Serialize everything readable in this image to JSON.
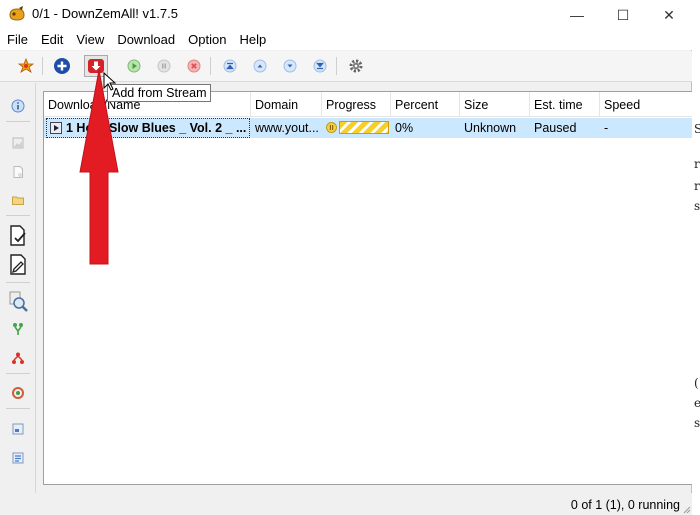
{
  "window": {
    "title": "0/1 - DownZemAll! v1.7.5",
    "controls": {
      "minimize": "—",
      "maximize": "☐",
      "close": "✕"
    }
  },
  "menu": [
    "File",
    "Edit",
    "View",
    "Download",
    "Option",
    "Help"
  ],
  "toolbar": {
    "tooltip": "Add from Stream",
    "buttons": [
      "wizard-icon",
      "add-icon",
      "add-from-stream-icon",
      "start-icon",
      "pause-icon",
      "stop-icon",
      "move-top-icon",
      "move-up-icon",
      "move-down-icon",
      "move-bottom-icon",
      "settings-icon"
    ]
  },
  "table": {
    "columns": [
      "Download/Name",
      "Domain",
      "Progress",
      "Percent",
      "Size",
      "Est. time",
      "Speed"
    ],
    "rows": [
      {
        "name": "1 Hour Slow Blues _ Vol. 2 _ ...",
        "domain": "www.yout...",
        "percent": "0%",
        "size": "Unknown",
        "est_time": "Paused",
        "speed": "-"
      }
    ]
  },
  "status": "0 of 1 (1), 0 running",
  "background_fragments": [
    "S",
    "r",
    "r",
    "s",
    "(",
    "e",
    "s"
  ],
  "colors": {
    "accent_red": "#e31b23",
    "selection": "#cce8ff",
    "progress_stripe": "#f7cf2d"
  }
}
